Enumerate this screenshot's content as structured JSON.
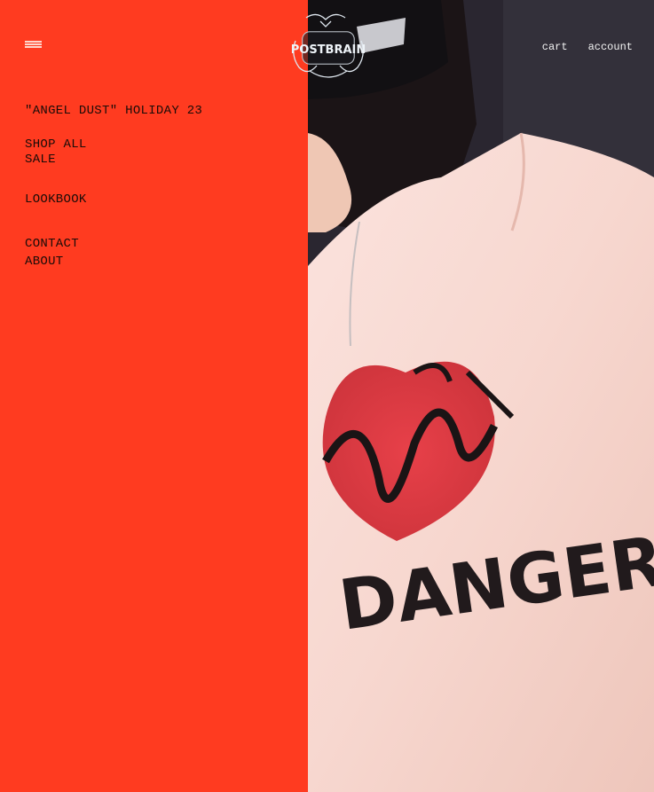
{
  "menu_icon": "hamburger-menu-icon",
  "brand": {
    "logo_text": "POSTBRAIN",
    "logo_icon": "winged-face-logo-icon"
  },
  "header_links": {
    "cart": "cart",
    "account": "account"
  },
  "nav": {
    "collection": "\"ANGEL DUST\" HOLIDAY 23",
    "shop_all": "SHOP ALL",
    "sale": "SALE",
    "lookbook": "LOOKBOOK",
    "contact": "CONTACT",
    "about": "ABOUT"
  },
  "hero_shirt_text": "DANGER",
  "colors": {
    "panel": "#ff3b20",
    "text": "#1a0c08"
  }
}
